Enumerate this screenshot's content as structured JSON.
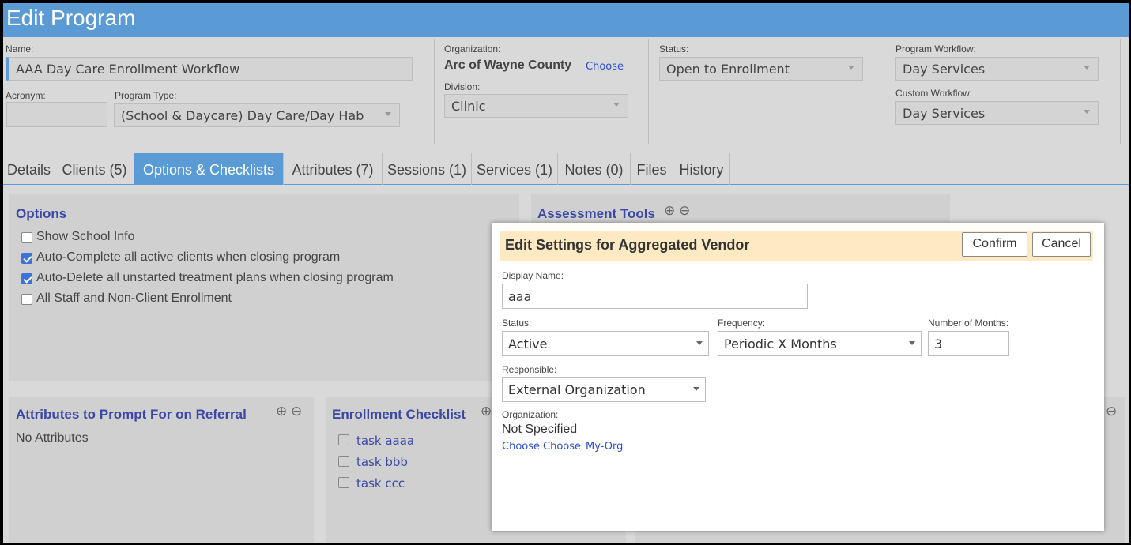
{
  "page_title": "Edit Program",
  "form": {
    "name_label": "Name:",
    "name_value": "AAA Day Care Enrollment Workflow",
    "acronym_label": "Acronym:",
    "acronym_value": "",
    "program_type_label": "Program Type:",
    "program_type_value": "(School & Daycare) Day Care/Day Hab",
    "organization_label": "Organization:",
    "organization_value": "Arc of Wayne County",
    "organization_choose": "Choose",
    "division_label": "Division:",
    "division_value": "Clinic",
    "status_label": "Status:",
    "status_value": "Open to Enrollment",
    "program_workflow_label": "Program Workflow:",
    "program_workflow_value": "Day Services",
    "custom_workflow_label": "Custom Workflow:",
    "custom_workflow_value": "Day Services"
  },
  "tabs": [
    {
      "label": "Details"
    },
    {
      "label": "Clients (5)"
    },
    {
      "label": "Options & Checklists"
    },
    {
      "label": "Attributes (7)"
    },
    {
      "label": "Sessions (1)"
    },
    {
      "label": "Services (1)"
    },
    {
      "label": "Notes (0)"
    },
    {
      "label": "Files"
    },
    {
      "label": "History"
    }
  ],
  "active_tab": "Options & Checklists",
  "options": {
    "heading": "Options",
    "items": [
      {
        "label": "Show School Info",
        "checked": false
      },
      {
        "label": "Auto-Complete all active clients when closing program",
        "checked": true
      },
      {
        "label": "Auto-Delete all unstarted treatment plans when closing program",
        "checked": true
      },
      {
        "label": "All Staff and Non-Client Enrollment",
        "checked": false
      }
    ]
  },
  "assessment_tools": {
    "heading": "Assessment Tools"
  },
  "attributes_prompt": {
    "heading": "Attributes to Prompt For on Referral",
    "empty_text": "No Attributes"
  },
  "enrollment_checklist": {
    "heading": "Enrollment Checklist",
    "tasks": [
      "task aaaa",
      "task bbb",
      "task ccc"
    ]
  },
  "modal": {
    "title": "Edit Settings for Aggregated Vendor",
    "confirm_label": "Confirm",
    "cancel_label": "Cancel",
    "display_name_label": "Display Name:",
    "display_name_value": "aaa",
    "status_label": "Status:",
    "status_value": "Active",
    "frequency_label": "Frequency:",
    "frequency_value": "Periodic X Months",
    "months_label": "Number of Months:",
    "months_value": "3",
    "responsible_label": "Responsible:",
    "responsible_value": "External Organization",
    "organization_label": "Organization:",
    "organization_value": "Not Specified",
    "links": [
      "Choose",
      "Choose",
      "My-Org"
    ]
  },
  "colors": {
    "header": "#5b9bd5",
    "link": "#3b48a6",
    "modal_header": "#fde9c2"
  }
}
